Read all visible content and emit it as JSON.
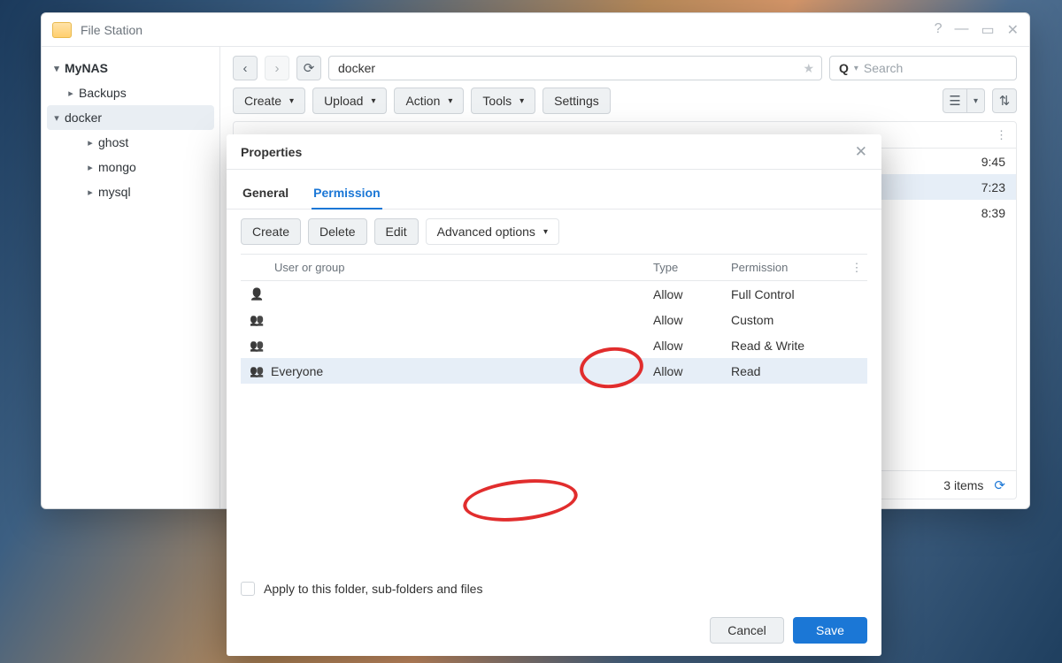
{
  "fileStation": {
    "title": "File Station",
    "path": "docker",
    "searchPlaceholder": "Search",
    "toolbar": {
      "create": "Create",
      "upload": "Upload",
      "action": "Action",
      "tools": "Tools",
      "settings": "Settings"
    },
    "tree": {
      "root": "MyNAS",
      "items": [
        {
          "label": "Backups"
        },
        {
          "label": "docker",
          "selected": true,
          "children": [
            {
              "label": "ghost"
            },
            {
              "label": "mongo"
            },
            {
              "label": "mysql"
            }
          ]
        }
      ]
    },
    "table": {
      "rowsTimeSuffix": [
        "9:45",
        "7:23",
        "8:39"
      ],
      "footer": "3 items"
    }
  },
  "properties": {
    "title": "Properties",
    "tabs": {
      "general": "General",
      "permission": "Permission"
    },
    "toolbar": {
      "create": "Create",
      "delete": "Delete",
      "edit": "Edit",
      "advanced": "Advanced options"
    },
    "columns": {
      "userOrGroup": "User or group",
      "type": "Type",
      "permission": "Permission"
    },
    "rows": [
      {
        "icon": "user",
        "name": "",
        "type": "Allow",
        "perm": "Full Control"
      },
      {
        "icon": "group",
        "name": "",
        "type": "Allow",
        "perm": "Custom"
      },
      {
        "icon": "group",
        "name": "",
        "type": "Allow",
        "perm": "Read & Write"
      },
      {
        "icon": "group",
        "name": "Everyone",
        "type": "Allow",
        "perm": "Read",
        "selected": true
      }
    ],
    "applyLabel": "Apply to this folder, sub-folders and files",
    "cancel": "Cancel",
    "save": "Save"
  }
}
